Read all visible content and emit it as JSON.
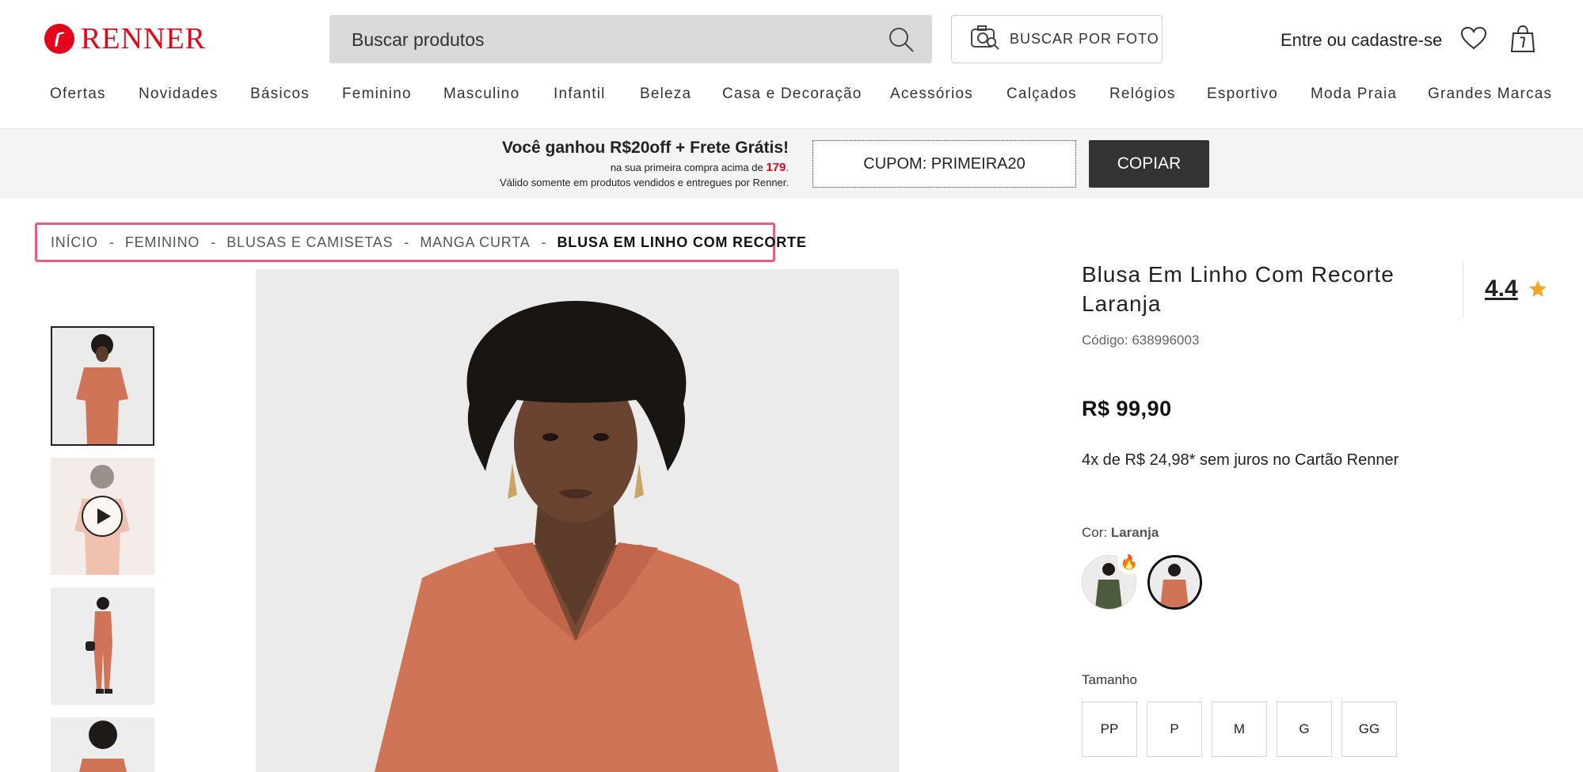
{
  "header": {
    "logo_text": "RENNER",
    "search_placeholder": "Buscar produtos",
    "photo_search_label": "BUSCAR POR FOTO",
    "login_label": "Entre ou cadastre-se",
    "brand_color": "#e3051b"
  },
  "nav": {
    "items": [
      "Ofertas",
      "Novidades",
      "Básicos",
      "Feminino",
      "Masculino",
      "Infantil",
      "Beleza",
      "Casa e Decoração",
      "Acessórios",
      "Calçados",
      "Relógios",
      "Esportivo",
      "Moda Praia",
      "Grandes Marcas"
    ]
  },
  "promo": {
    "title": "Você ganhou R$20off + Frete Grátis!",
    "sub_prefix": "na sua primeira compra acima de ",
    "sub_value": "179",
    "sub_suffix": ".",
    "note": "Válido somente em produtos vendidos e entregues por Renner.",
    "coupon": "CUPOM: PRIMEIRA20",
    "copy_label": "COPIAR"
  },
  "breadcrumb": {
    "items": [
      "INÍCIO",
      "FEMININO",
      "BLUSAS E CAMISETAS",
      "MANGA CURTA",
      "BLUSA EM LINHO COM RECORTE"
    ],
    "separator": "-",
    "highlight_color": "#ea5c85"
  },
  "gallery": {
    "thumbnails": [
      {
        "type": "image",
        "active": true,
        "icon": "model-photo"
      },
      {
        "type": "video",
        "active": false,
        "icon": "play-icon"
      },
      {
        "type": "image",
        "active": false,
        "icon": "model-photo"
      },
      {
        "type": "image",
        "active": false,
        "icon": "model-photo"
      }
    ]
  },
  "product": {
    "title": "Blusa Em Linho Com Recorte Laranja",
    "rating": "4.4",
    "code_label": "Código: 638996003",
    "price": "R$ 99,90",
    "installments": "4x de R$ 24,98* sem juros no Cartão Renner",
    "color_prefix": "Cor: ",
    "color_name": "Laranja",
    "size_label": "Tamanho",
    "sizes": [
      "PP",
      "P",
      "M",
      "G",
      "GG"
    ],
    "garment_color": "#d07458",
    "star_color": "#f5a623"
  }
}
